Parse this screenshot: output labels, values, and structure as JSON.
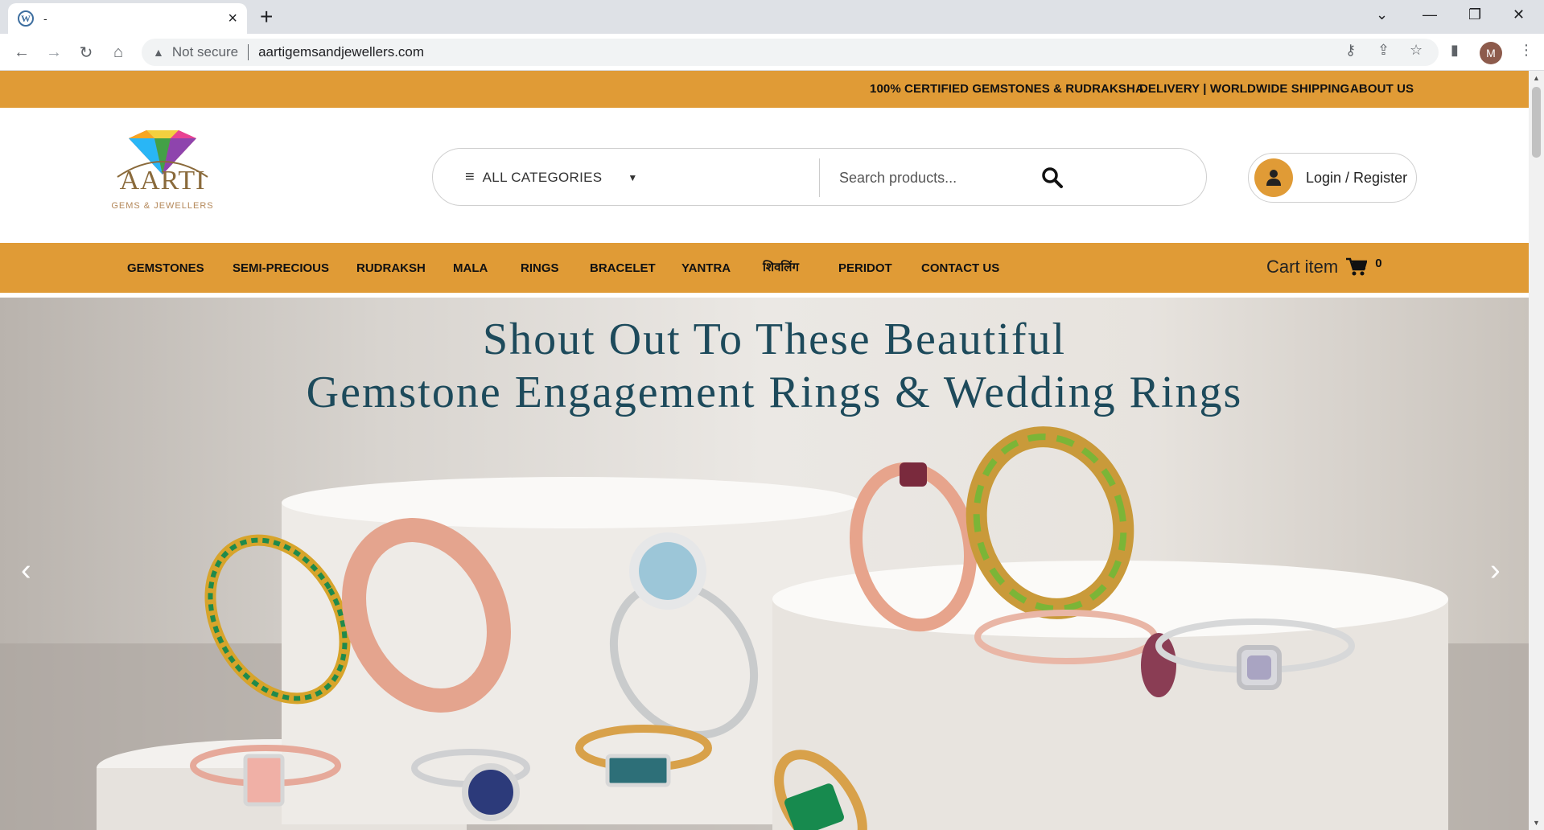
{
  "browser": {
    "tab_title": "-",
    "tab_close": "×",
    "new_tab": "+",
    "security_label": "Not secure",
    "url": "aartigemsandjewellers.com",
    "profile_initial": "M"
  },
  "topbar": {
    "links": [
      "100% CERTIFIED GEMSTONES & RUDRAKSHA",
      "DELIVERY | WORLDWIDE SHIPPING",
      "ABOUT US"
    ]
  },
  "header": {
    "logo_text": "AARTI",
    "logo_tagline": "GEMS & JEWELLERS",
    "categories_label": "ALL CATEGORIES",
    "search_placeholder": "Search products...",
    "login_label": "Login / Register"
  },
  "nav": {
    "items": [
      "GEMSTONES",
      "SEMI-PRECIOUS",
      "RUDRAKSH",
      "MALA",
      "RINGS",
      "BRACELET",
      "YANTRA",
      "शिवलिंग",
      "PERIDOT",
      "CONTACT US"
    ],
    "cart_label": "Cart item",
    "cart_count": "0"
  },
  "hero": {
    "title_line1": "Shout Out To These Beautiful",
    "title_line2": "Gemstone Engagement Rings & Wedding Rings",
    "prev_arrow": "‹",
    "next_arrow": "›"
  },
  "colors": {
    "accent": "#e09b36",
    "hero_text": "#1d4a5b"
  }
}
